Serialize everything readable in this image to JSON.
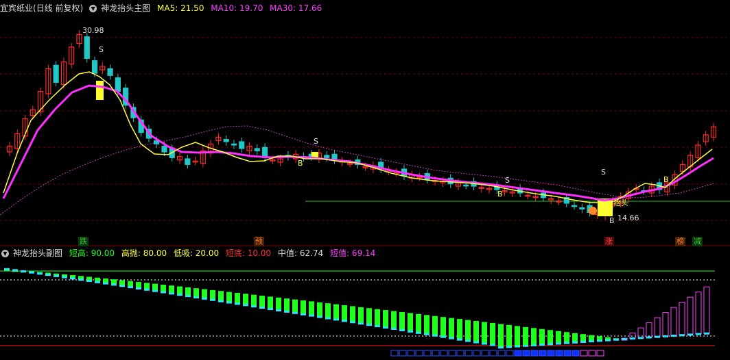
{
  "main_header": {
    "stock_name": "宜宾纸业",
    "period": "(日线 前复权)",
    "indicator_name": "神龙抬头主图",
    "ma5": "MA5: 21.50",
    "ma10": "MA10: 19.70",
    "ma30": "MA30: 17.66"
  },
  "sub_header": {
    "indicator_name": "神龙抬头副图",
    "short_high": "短高: 90.00",
    "high_throw": "高抛: 80.00",
    "low_buy": "低吸: 20.00",
    "short_bottom": "短底: 10.00",
    "mid_value": "中值: 62.74",
    "short_value": "短值: 69.14"
  },
  "main_annotations": {
    "high_price": "30.98",
    "low_price": "14.66",
    "dragon_head_label": "抬头",
    "sell_marks": [
      "S",
      "S",
      "S",
      "S"
    ],
    "buy_marks": [
      "B",
      "B",
      "B",
      "B"
    ]
  },
  "date_tags": [
    {
      "label": "跌",
      "color": "#3cb83c",
      "bg": "#0c3a0c"
    },
    {
      "label": "预",
      "color": "#f07a2c",
      "bg": "#4a2208"
    },
    {
      "label": "涨",
      "color": "#ff4040",
      "bg": "#4a0808"
    },
    {
      "label": "榜",
      "color": "#f07a2c",
      "bg": "#4a2208"
    },
    {
      "label": "减",
      "color": "#3cb83c",
      "bg": "#0c3a0c"
    }
  ],
  "colors": {
    "up": "#ff2b2b",
    "down": "#22c8c8",
    "ma5": "#ffff40",
    "ma10": "#ff40ff",
    "ma30": "#c040c0",
    "grid": "#7a0000",
    "sub_green": "#20ff20",
    "sub_cyan": "#30e0ff"
  },
  "chart_data": {
    "type": "candlestick",
    "price_high": 30.98,
    "price_low": 14.66,
    "ma_values": {
      "MA5": 21.5,
      "MA10": 19.7,
      "MA30": 17.66
    },
    "sub_indicator": {
      "short_high": 90.0,
      "high_throw": 80.0,
      "low_buy": 20.0,
      "short_bottom": 10.0,
      "mid_value": 62.74,
      "short_value": 69.14
    },
    "close_series": [
      20.8,
      21.9,
      23.2,
      24.0,
      25.6,
      27.6,
      26.4,
      28.2,
      29.5,
      30.6,
      28.5,
      27.2,
      27.8,
      27.0,
      25.6,
      24.4,
      23.3,
      22.0,
      21.5,
      21.0,
      20.3,
      19.8,
      19.9,
      19.2,
      19.5,
      20.4,
      21.0,
      21.6,
      21.2,
      20.9,
      20.6,
      20.8,
      20.4,
      19.8,
      19.6,
      19.7,
      19.9,
      20.1,
      19.8,
      19.9,
      20.2,
      19.8,
      19.6,
      19.5,
      19.3,
      19.2,
      19.0,
      19.1,
      18.8,
      18.7,
      18.5,
      18.2,
      18.3,
      18.1,
      17.9,
      17.8,
      17.7,
      17.5,
      17.6,
      17.4,
      17.3,
      17.2,
      17.1,
      17.0,
      16.9,
      16.8,
      16.7,
      16.5,
      16.4,
      16.3,
      16.2,
      16.0,
      15.8,
      15.6,
      15.3,
      15.0,
      14.9,
      15.4,
      16.0,
      16.4,
      16.8,
      17.1,
      16.9,
      17.3,
      17.0,
      17.6,
      18.3,
      19.2,
      20.0,
      20.9,
      21.8,
      22.5
    ]
  }
}
